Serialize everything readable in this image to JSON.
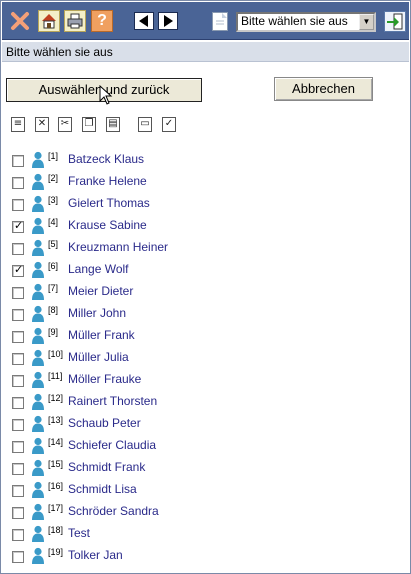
{
  "toolbar": {
    "close_icon": "close-x-icon",
    "home_icon": "home-icon",
    "print_icon": "printer-icon",
    "help_label": "?",
    "prev_icon": "arrow-left-icon",
    "next_icon": "arrow-right-icon",
    "document_icon": "document-icon",
    "select_value": "Bitte wählen sie aus",
    "go_icon": "go-arrow-icon"
  },
  "header": {
    "title": "Bitte wählen sie aus"
  },
  "actions": {
    "select_and_back_label": "Auswählen und zurück",
    "cancel_label": "Abbrechen"
  },
  "tools": [
    {
      "icon": "select-all-icon",
      "glyph": "≡"
    },
    {
      "icon": "delete-icon",
      "glyph": "✕"
    },
    {
      "icon": "cut-icon",
      "glyph": "✂"
    },
    {
      "icon": "copy-icon",
      "glyph": "❐"
    },
    {
      "icon": "paste-icon",
      "glyph": "▤"
    },
    {
      "icon": "print-icon",
      "glyph": "▭"
    },
    {
      "icon": "check-icon",
      "glyph": "✓"
    }
  ],
  "people": [
    {
      "num": "[1]",
      "name": "Batzeck Klaus",
      "checked": false
    },
    {
      "num": "[2]",
      "name": "Franke Helene",
      "checked": false
    },
    {
      "num": "[3]",
      "name": "Gielert Thomas",
      "checked": false
    },
    {
      "num": "[4]",
      "name": "Krause Sabine",
      "checked": true
    },
    {
      "num": "[5]",
      "name": "Kreuzmann Heiner",
      "checked": false
    },
    {
      "num": "[6]",
      "name": "Lange Wolf",
      "checked": true
    },
    {
      "num": "[7]",
      "name": "Meier Dieter",
      "checked": false
    },
    {
      "num": "[8]",
      "name": "Miller John",
      "checked": false
    },
    {
      "num": "[9]",
      "name": "Müller Frank",
      "checked": false
    },
    {
      "num": "[10]",
      "name": "Müller Julia",
      "checked": false
    },
    {
      "num": "[11]",
      "name": "Möller Frauke",
      "checked": false
    },
    {
      "num": "[12]",
      "name": "Rainert Thorsten",
      "checked": false
    },
    {
      "num": "[13]",
      "name": "Schaub Peter",
      "checked": false
    },
    {
      "num": "[14]",
      "name": "Schiefer Claudia",
      "checked": false
    },
    {
      "num": "[15]",
      "name": "Schmidt Frank",
      "checked": false
    },
    {
      "num": "[16]",
      "name": "Schmidt Lisa",
      "checked": false
    },
    {
      "num": "[17]",
      "name": "Schröder Sandra",
      "checked": false
    },
    {
      "num": "[18]",
      "name": "Test",
      "checked": false
    },
    {
      "num": "[19]",
      "name": "Tolker Jan",
      "checked": false
    }
  ]
}
